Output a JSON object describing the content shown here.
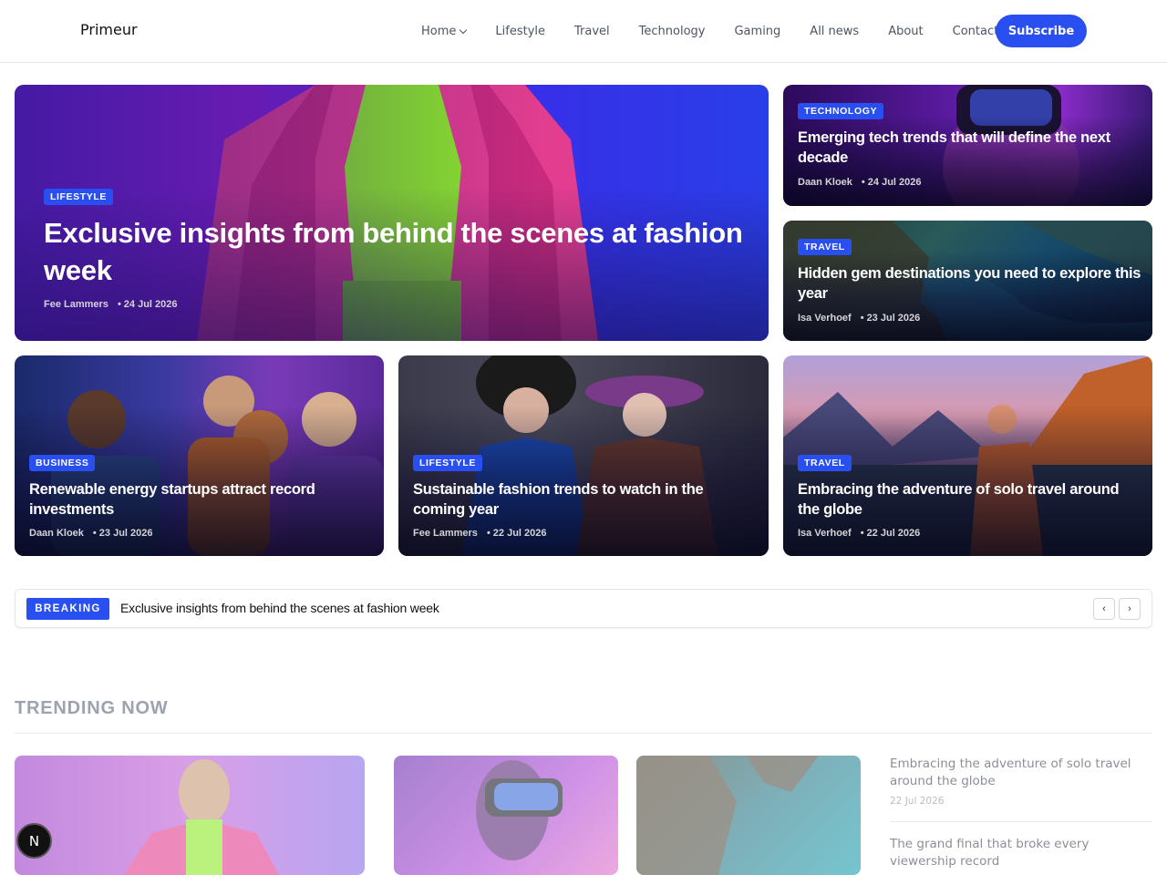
{
  "header": {
    "logo": "Primeur",
    "nav": [
      {
        "label": "Home",
        "has_dropdown": true
      },
      {
        "label": "Lifestyle"
      },
      {
        "label": "Travel"
      },
      {
        "label": "Technology"
      },
      {
        "label": "Gaming"
      },
      {
        "label": "All news"
      },
      {
        "label": "About"
      },
      {
        "label": "Contact"
      }
    ],
    "subscribe_label": "Subscribe"
  },
  "hero": {
    "category": "LIFESTYLE",
    "title": "Exclusive insights from behind the scenes at fashion week",
    "author": "Fee Lammers",
    "date": "24 Jul 2026"
  },
  "side_cards": [
    {
      "category": "TECHNOLOGY",
      "title": "Emerging tech trends that will define the next decade",
      "author": "Daan Kloek",
      "date": "24 Jul 2026"
    },
    {
      "category": "TRAVEL",
      "title": "Hidden gem destinations you need to explore this year",
      "author": "Isa Verhoef",
      "date": "23 Jul 2026"
    }
  ],
  "row_cards": [
    {
      "category": "BUSINESS",
      "title": "Renewable energy startups attract record investments",
      "author": "Daan Kloek",
      "date": "23 Jul 2026"
    },
    {
      "category": "LIFESTYLE",
      "title": "Sustainable fashion trends to watch in the coming year",
      "author": "Fee Lammers",
      "date": "22 Jul 2026"
    },
    {
      "category": "TRAVEL",
      "title": "Embracing the adventure of solo travel around the globe",
      "author": "Isa Verhoef",
      "date": "22 Jul 2026"
    }
  ],
  "breaking": {
    "label": "BREAKING",
    "text": "Exclusive insights from behind the scenes at fashion week",
    "prev_icon": "‹",
    "next_icon": "›"
  },
  "trending": {
    "title": "TRENDING NOW",
    "side_items": [
      {
        "title": "Embracing the adventure of solo travel around the globe",
        "date": "22 Jul 2026"
      },
      {
        "title": "The grand final that broke every viewership record",
        "date": ""
      }
    ]
  },
  "dev_badge": "N",
  "colors": {
    "accent": "#2a4ff0"
  }
}
